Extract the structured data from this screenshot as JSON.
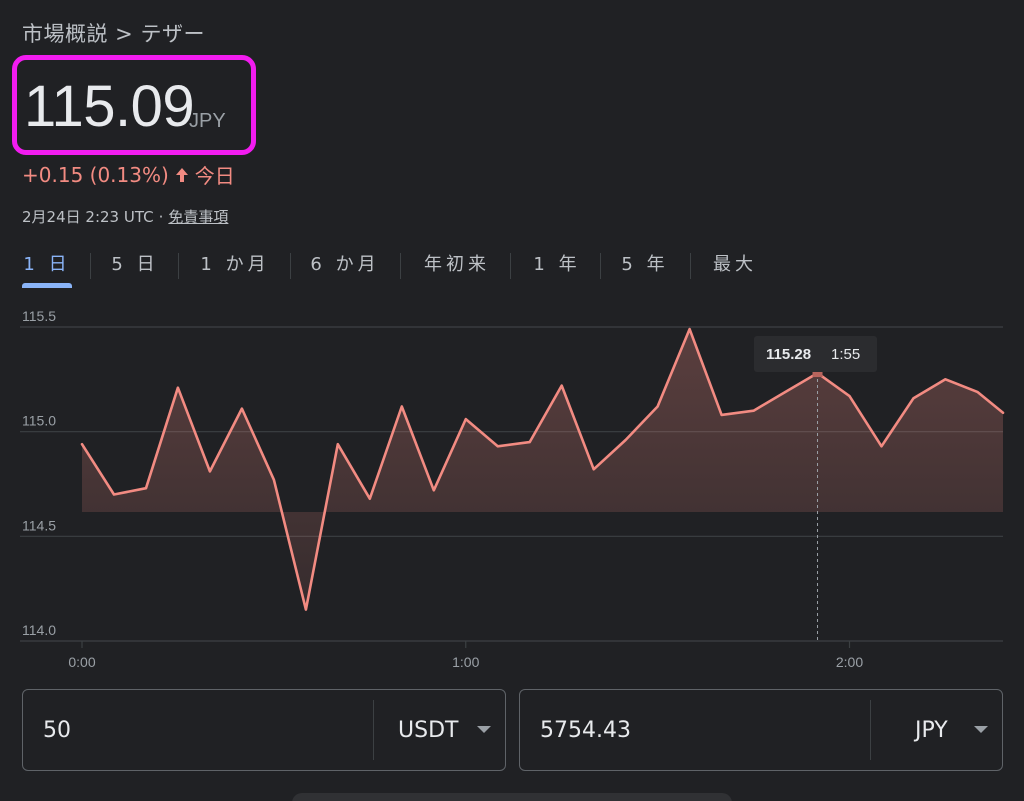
{
  "breadcrumb": "市場概説 > テザー",
  "price": {
    "value": "115.09",
    "currency": "JPY"
  },
  "change": {
    "text": "+0.15 (0.13%)",
    "icon": "arrow-up-icon",
    "period": "今日"
  },
  "meta": {
    "timestamp": "2月24日 2:23 UTC",
    "separator": "·",
    "disclaimer": "免責事項"
  },
  "tabs": [
    {
      "label": "1 日",
      "active": true
    },
    {
      "label": "5 日",
      "active": false
    },
    {
      "label": "1 か月",
      "active": false
    },
    {
      "label": "6 か月",
      "active": false
    },
    {
      "label": "年初来",
      "active": false
    },
    {
      "label": "1 年",
      "active": false
    },
    {
      "label": "5 年",
      "active": false
    },
    {
      "label": "最大",
      "active": false
    }
  ],
  "colors": {
    "line": "#f28b82",
    "accent": "#8ab4f8",
    "highlight_border": "#f21cf0",
    "grid": "#3c4043",
    "background": "#202124"
  },
  "chart_data": {
    "type": "area",
    "title": "",
    "xlabel": "",
    "ylabel": "",
    "ylim": [
      114.0,
      115.5
    ],
    "y_ticks": [
      "115.5",
      "115.0",
      "114.5",
      "114.0"
    ],
    "x_ticks": [
      "0:00",
      "1:00",
      "2:00"
    ],
    "xlim_minutes": [
      0,
      144
    ],
    "grid": true,
    "series": [
      {
        "x_minutes": [
          0,
          5,
          10,
          15,
          20,
          25,
          30,
          35,
          40,
          45,
          50,
          55,
          60,
          65,
          70,
          75,
          80,
          85,
          90,
          95,
          100,
          105,
          110,
          115,
          120,
          125,
          130,
          135,
          140,
          144
        ],
        "values": [
          114.94,
          114.7,
          114.73,
          115.21,
          114.81,
          115.11,
          114.77,
          114.15,
          114.94,
          114.68,
          115.12,
          114.72,
          115.06,
          114.93,
          114.95,
          115.22,
          114.82,
          114.96,
          115.12,
          115.49,
          115.08,
          115.1,
          115.19,
          115.28,
          115.17,
          114.93,
          115.16,
          115.25,
          115.19,
          115.09
        ]
      }
    ],
    "tooltip": {
      "value": "115.28",
      "time": "1:55",
      "x_minutes": 115
    }
  },
  "converter": {
    "from": {
      "amount": "50",
      "currency": "USDT"
    },
    "to": {
      "amount": "5754.43",
      "currency": "JPY"
    }
  }
}
